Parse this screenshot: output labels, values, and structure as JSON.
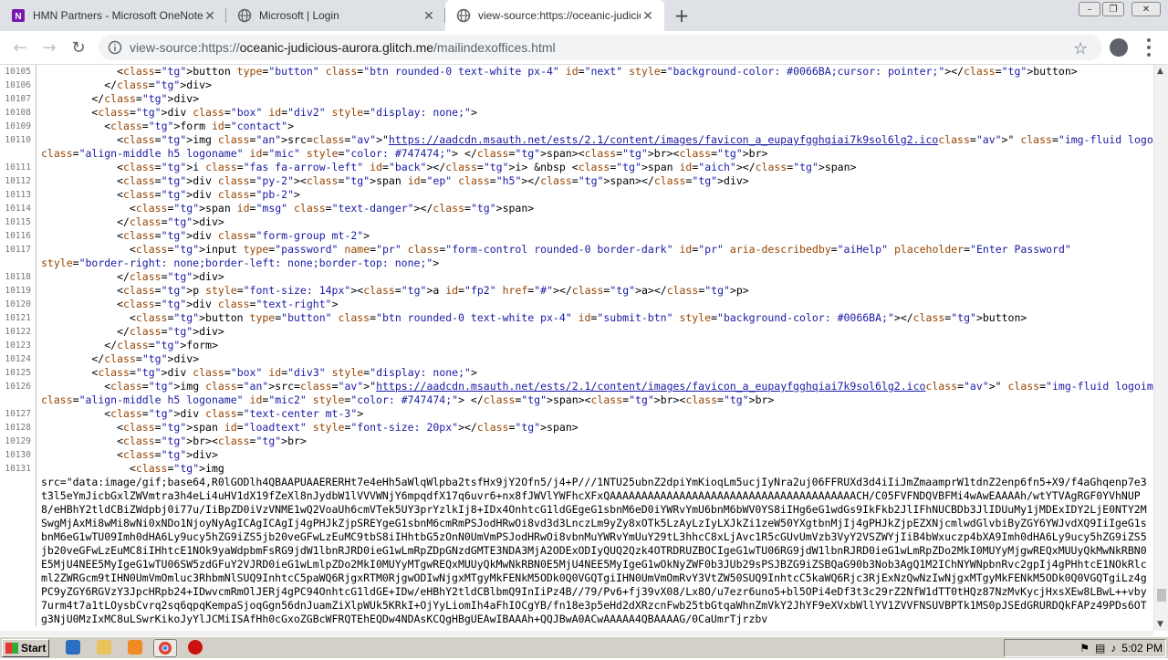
{
  "tabs": [
    {
      "title": "HMN Partners - Microsoft OneNote O",
      "icon": "onenote-icon",
      "close": "✕"
    },
    {
      "title": "Microsoft | Login",
      "icon": "globe-icon",
      "close": "✕"
    },
    {
      "title": "view-source:https://oceanic-judicio",
      "icon": "globe-icon",
      "close": "✕"
    }
  ],
  "new_tab": "+",
  "window_controls": {
    "minimize": "–",
    "maximize": "❐",
    "close": "✕"
  },
  "toolbar": {
    "back": "←",
    "forward": "→",
    "reload": "↻",
    "url_prefix": "view-source:https://",
    "url_host": "oceanic-judicious-aurora.glitch.me",
    "url_path": "/mailindexoffices.html",
    "star": "☆"
  },
  "source_lines": [
    {
      "n": "10105",
      "t": "            <button type=\"button\" class=\"btn rounded-0 text-white px-4\" id=\"next\" style=\"background-color: #0066BA;cursor: pointer;\"></button>"
    },
    {
      "n": "10106",
      "t": "          </div>"
    },
    {
      "n": "10107",
      "t": "        </div>"
    },
    {
      "n": "10108",
      "t": "        <div class=\"box\" id=\"div2\" style=\"display: none;\">"
    },
    {
      "n": "10109",
      "t": "          <form id=\"contact\">"
    },
    {
      "n": "10110",
      "t": "            <img src=\"https://aadcdn.msauth.net/ests/2.1/content/images/favicon_a_eupayfgghqiai7k9sol6lg2.ico\" class=\"img-fluid logoimg\" width=\"30px\">&nbsp <span",
      "c": "class=\"align-middle h5 logoname\" id=\"mic\" style=\"color: #747474;\"> </span><br><br>"
    },
    {
      "n": "10111",
      "t": "            <i class=\"fas fa-arrow-left\" id=\"back\"></i> &nbsp <span id=\"aich\"></span>"
    },
    {
      "n": "10112",
      "t": "            <div class=\"py-2\"><span id=\"ep\" class=\"h5\"></span></div>"
    },
    {
      "n": "10113",
      "t": "            <div class=\"pb-2\">"
    },
    {
      "n": "10114",
      "t": "              <span id=\"msg\" class=\"text-danger\"></span>"
    },
    {
      "n": "10115",
      "t": "            </div>"
    },
    {
      "n": "10116",
      "t": "            <div class=\"form-group mt-2\">"
    },
    {
      "n": "10117",
      "t": "              <input type=\"password\" name=\"pr\" class=\"form-control rounded-0 border-dark\" id=\"pr\" aria-describedby=\"aiHelp\" placeholder=\"Enter Password\"",
      "c": "style=\"border-right: none;border-left: none;border-top: none;\">"
    },
    {
      "n": "10118",
      "t": "            </div>"
    },
    {
      "n": "10119",
      "t": "            <p style=\"font-size: 14px\"><a id=\"fp2\" href=\"#\"></a></p>"
    },
    {
      "n": "10120",
      "t": "            <div class=\"text-right\">"
    },
    {
      "n": "10121",
      "t": "              <button type=\"button\" class=\"btn rounded-0 text-white px-4\" id=\"submit-btn\" style=\"background-color: #0066BA;\"></button>"
    },
    {
      "n": "10122",
      "t": "            </div>"
    },
    {
      "n": "10123",
      "t": "          </form>"
    },
    {
      "n": "10124",
      "t": "        </div>"
    },
    {
      "n": "10125",
      "t": "        <div class=\"box\" id=\"div3\" style=\"display: none;\">"
    },
    {
      "n": "10126",
      "t": "          <img src=\"https://aadcdn.msauth.net/ests/2.1/content/images/favicon_a_eupayfgghqiai7k9sol6lg2.ico\" class=\"img-fluid logoimg\" width=\"30px\">&nbsp <span",
      "c": "class=\"align-middle h5 logoname\" id=\"mic2\" style=\"color: #747474;\"> </span><br><br>"
    },
    {
      "n": "10127",
      "t": "          <div class=\"text-center mt-3\">"
    },
    {
      "n": "10128",
      "t": "            <span id=\"loadtext\" style=\"font-size: 20px\"></span>"
    },
    {
      "n": "10129",
      "t": "            <br><br>"
    },
    {
      "n": "10130",
      "t": "            <div>"
    },
    {
      "n": "10131",
      "t": "              <img",
      "c": "src=\"data:image/gif;base64,R0lGODlh4QBAAPUAAERERHt7e4eHh5aWlqWlpba2tsfHx9jY2Ofn5/j4+P///1NTU25ubnZ2dpiYmKioqLm5ucjIyNra2uj06FFRUXd3d4iIiJmZmaamprW1tdnZ2enp6fn5+X9/f4aGhqenp7e3t3l5eYmJicbGxlZWVmtra3h4eLi4uHV1dX19fZeXl8nJydbW1lVVVWNjY6mpqdfX17q6uvr6+nx8fJWVlYWFhcXFxQAAAAAAAAAAAAAAAAAAAAAAAAAAAAAAAAAAAAAAACH/C05FVFNDQVBFMi4wAwEAAAAh/wtYTVAgRGF0YVhNUP8/eHBhY2tldCBiZWdpbj0i77u/IiBpZD0iVzVNME1wQ2VoaUh6cmVTek5UY3prYzlkIj8+IDx4OnhtcG1ldGEgeG1sbnM6eD0iYWRvYmU6bnM6bWV0YS8iIHg6eG1wdGs9IkFkb2JlIFhNUCBDb3JlIDUuMy1jMDExIDY2LjE0NTY2MSwgMjAxMi8wMi8wNi0xNDo1NjoyNyAgICAgICAgIj4gPHJkZjpSREYgeG1sbnM6cmRmPSJodHRwOi8vd3d3LnczLm9yZy8xOTk5LzAyLzIyLXJkZi1zeW50YXgtbnMjIj4gPHJkZjpEZXNjcmlwdGlvbiByZGY6YWJvdXQ9IiIgeG1sbnM6eG1wTU09Imh0dHA6Ly9ucy5hZG9iZS5jb20veGFwLzEuMC9tbS8iIHhtbG5zOnN0UmVmPSJodHRwOi8vbnMuYWRvYmUuY29tL3hhcC8xLjAvc1R5cGUvUmVzb3VyY2VSZWYjIiB4bWxuczp4bXA9Imh0dHA6Ly9ucy5hZG9iZS5jb20veGFwLzEuMC8iIHhtcE1NOk9yaWdpbmFsRG9jdW1lbnRJRD0ieG1wLmRpZDpGNzdGMTE3NDA3MjA2ODExODIyQUQ2Qzk4OTRDRUZBOCIgeG1wTU06RG9jdW1lbnRJRD0ieG1wLmRpZDo2MkI0MUYyMjgwREQxMUUyQkMwNkRBN0E5MjU4NEE5MyIgeG1wTU06SW5zdGFuY2VJRD0ieG1wLmlpZDo2MkI0MUYyMTgwREQxMUUyQkMwNkRBN0E5MjU4NEE5MyIgeG1wOkNyZWF0b3JUb29sPSJBZG9iZSBQaG90b3Nob3AgQ1M2IChNYWNpbnRvc2gpIj4gPHhtcE1NOkRlcml2ZWRGcm9tIHN0UmVmOmluc3RhbmNlSUQ9InhtcC5paWQ6RjgxRTM0RjgwODIwNjgxMTgyMkFENkM5ODk0Q0VGQTgiIHN0UmVmOmRvY3VtZW50SUQ9InhtcC5kaWQ6Rjc3RjExNzQwNzIwNjgxMTgyMkFENkM5ODk0Q0VGQTgiLz4gPC9yZGY6RGVzY3JpcHRpb24+IDwvcmRmOlJERj4gPC94OnhtcG1ldGE+IDw/eHBhY2tldCBlbmQ9InIiPz4B//79/Pv6+fj39vX08/Lx8O/u7ezr6uno5+bl5OPi4eDf3t3c29rZ2NfW1dTT0tHQz87NzMvKycjHxsXEw8LBwL++vby7urm4t7a1tLOysbCvrq2sq6qpqKempaSjoqGgn56dnJuamZiXlpWUk5KRkI+OjYyLiomIh4aFhIOCgYB/fn18e3p5eHd2dXRzcnFwb25tbGtqaWhnZmVkY2JhYF9eXVxbWllYV1ZVVFNSUVBPTk1MS0pJSEdGRURDQkFAPz49PDs6OTg3NjU0MzIxMC8uLSwrKikoJyYlJCMiISAfHh0cGxoZGBcWFRQTEhEQDw4NDAsKCQgHBgUEAwIBAAAh+QQJBwA0ACwAAAAA4QBAAAAG/0CaUmrTjrzbv"
    }
  ],
  "taskbar": {
    "start_label": "Start",
    "clock": "5:02 PM"
  }
}
